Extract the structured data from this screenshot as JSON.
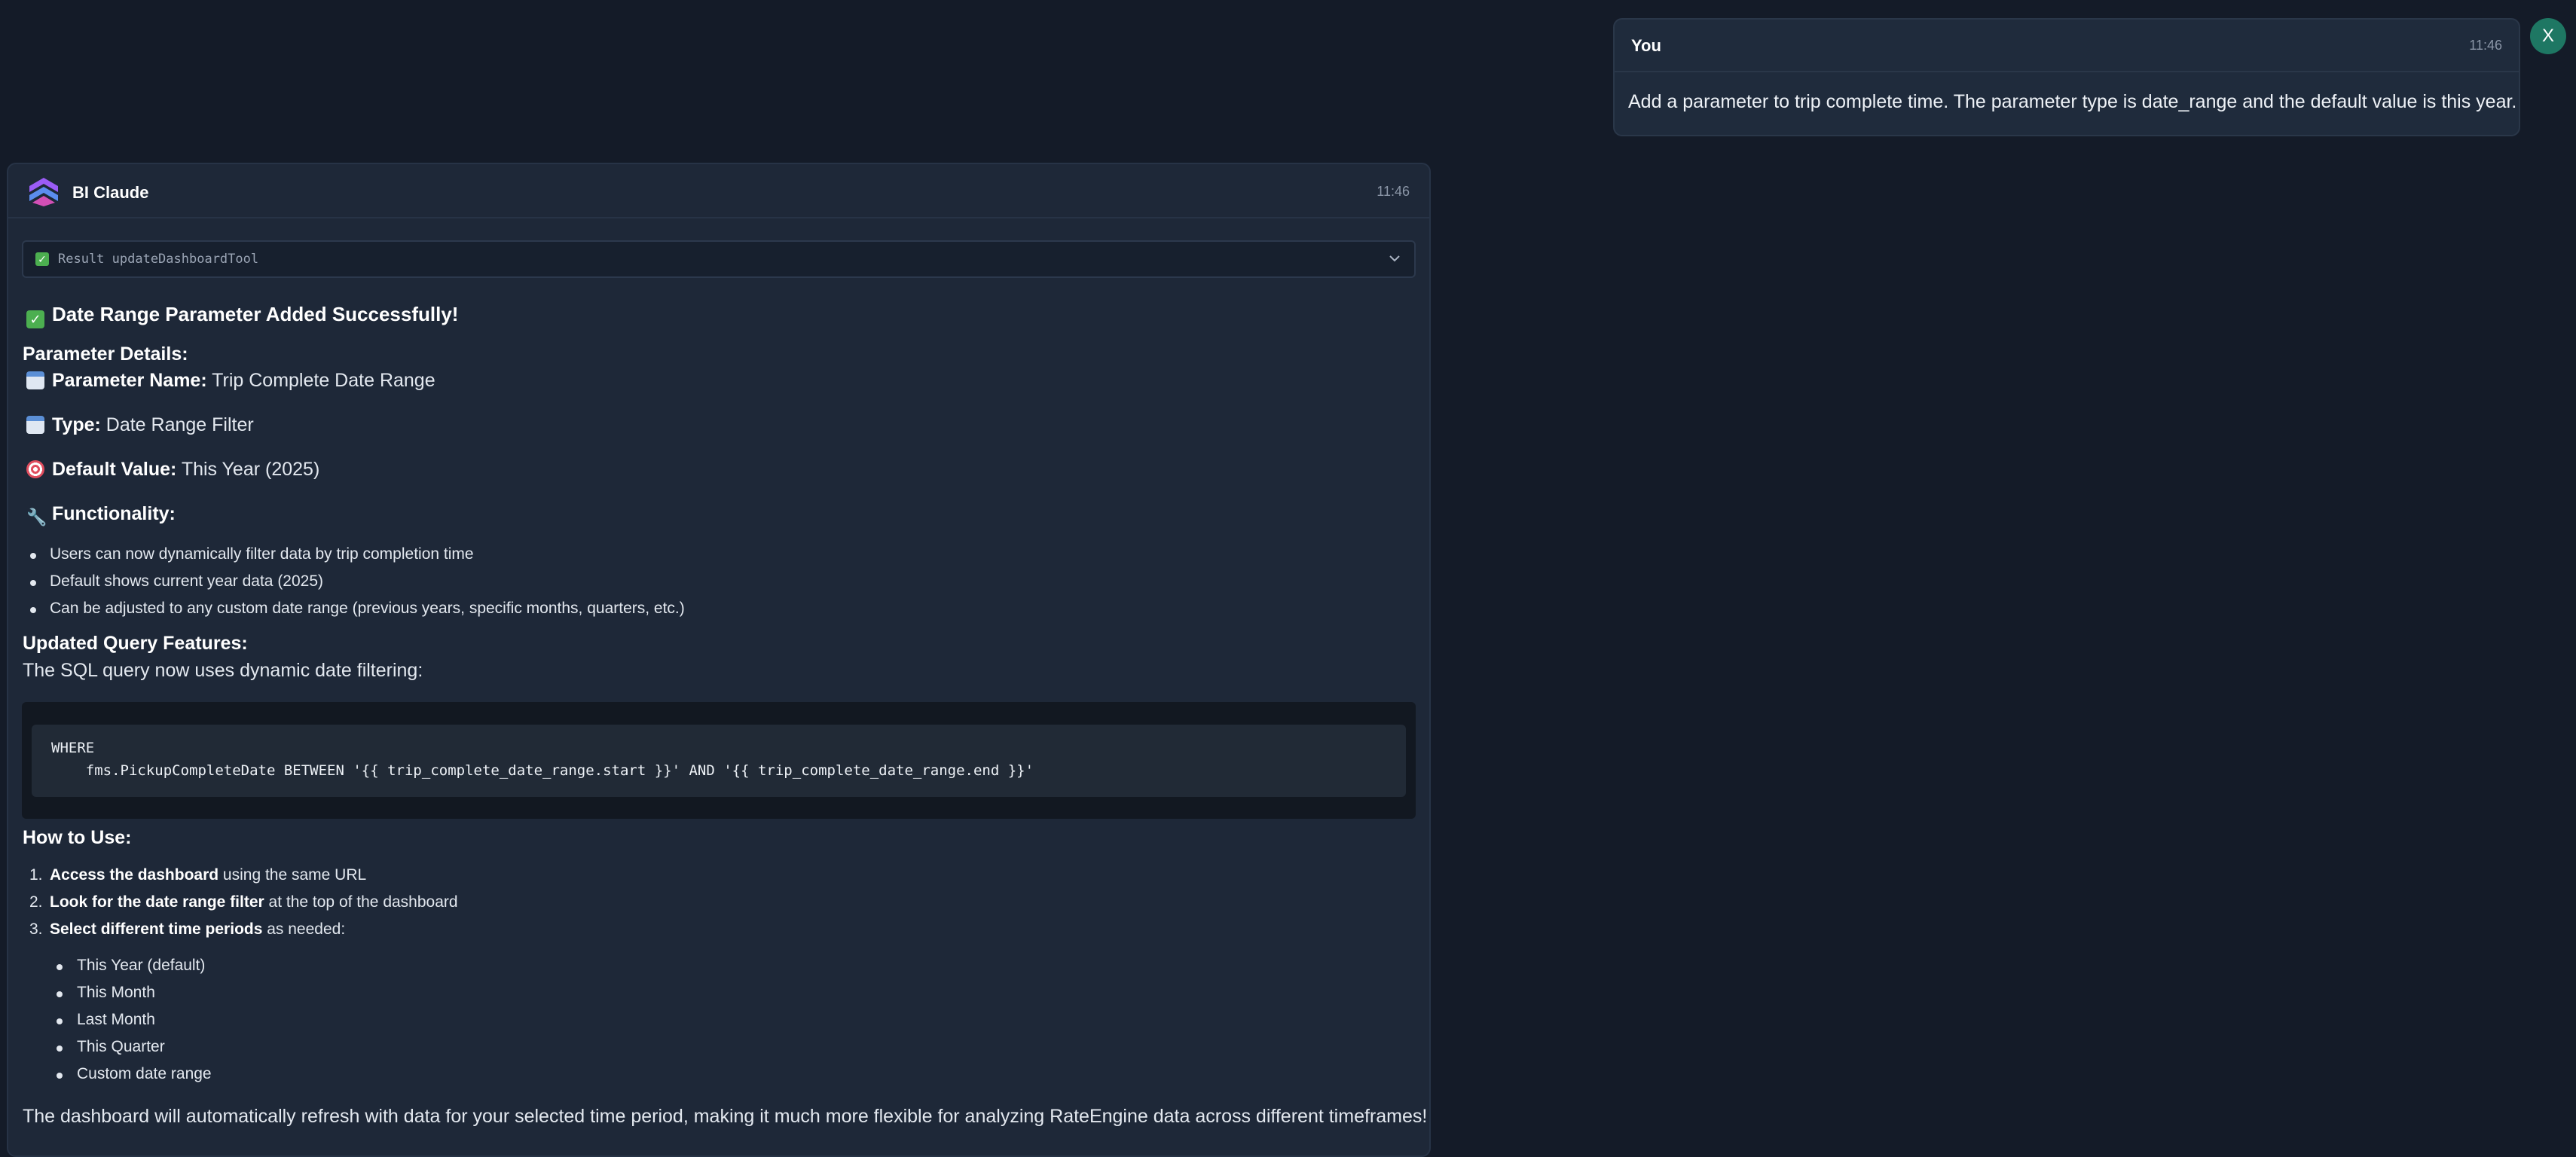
{
  "user_message": {
    "author": "You",
    "time": "11:46",
    "text": "Add a parameter to trip complete time. The parameter type is date_range and the default value is this year.",
    "avatar_initial": "X"
  },
  "assistant_message": {
    "author": "BI Claude",
    "time": "11:46",
    "tool_result_label": "Result updateDashboardTool",
    "success_title": "Date Range Parameter Added Successfully!",
    "parameter_details_heading": "Parameter Details:",
    "details": [
      {
        "icon": "calendar-icon",
        "label": "Parameter Name:",
        "value": "Trip Complete Date Range"
      },
      {
        "icon": "calendar-icon",
        "label": "Type:",
        "value": "Date Range Filter"
      },
      {
        "icon": "target-icon",
        "label": "Default Value:",
        "value": "This Year (2025)"
      }
    ],
    "functionality_heading": "Functionality:",
    "functionality_items": [
      "Users can now dynamically filter data by trip completion time",
      "Default shows current year data (2025)",
      "Can be adjusted to any custom date range (previous years, specific months, quarters, etc.)"
    ],
    "query_heading": "Updated Query Features:",
    "query_intro": "The SQL query now uses dynamic date filtering:",
    "code_lines": [
      "WHERE",
      "    fms.PickupCompleteDate BETWEEN '{{ trip_complete_date_range.start }}' AND '{{ trip_complete_date_range.end }}'"
    ],
    "how_to_heading": "How to Use:",
    "steps": [
      {
        "num": "1.",
        "bold": "Access the dashboard",
        "rest": " using the same URL"
      },
      {
        "num": "2.",
        "bold": "Look for the date range filter",
        "rest": " at the top of the dashboard"
      },
      {
        "num": "3.",
        "bold": "Select different time periods",
        "rest": " as needed:"
      }
    ],
    "period_options": [
      "This Year (default)",
      "This Month",
      "Last Month",
      "This Quarter",
      "Custom date range"
    ],
    "closing_text": "The dashboard will automatically refresh with data for your selected time period, making it much more flexible for analyzing RateEngine data across different timeframes!"
  },
  "colors": {
    "background": "#141b28",
    "card": "#1e2838",
    "avatar": "#1e7763",
    "success": "#4caf50"
  }
}
